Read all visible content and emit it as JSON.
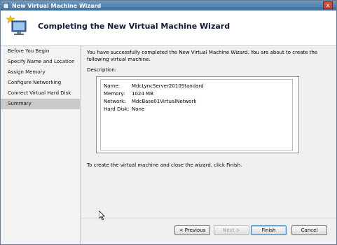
{
  "window": {
    "title": "New Virtual Machine Wizard",
    "close_glyph": "x"
  },
  "header": {
    "title": "Completing the New Virtual Machine Wizard",
    "icon": "wizard-computer-icon"
  },
  "nav": {
    "items": [
      {
        "label": "Before You Begin",
        "active": false
      },
      {
        "label": "Specify Name and Location",
        "active": false
      },
      {
        "label": "Assign Memory",
        "active": false
      },
      {
        "label": "Configure Networking",
        "active": false
      },
      {
        "label": "Connect Virtual Hard Disk",
        "active": false
      },
      {
        "label": "Summary",
        "active": true
      }
    ]
  },
  "content": {
    "intro_line1": "You have successfully completed the New Virtual Machine Wizard. You are about to create the",
    "intro_line2": "following virtual machine.",
    "description_label": "Description:",
    "description": [
      {
        "key": "Name:",
        "value": "MdcLyncServer2010Standard"
      },
      {
        "key": "Memory:",
        "value": "1024 MB"
      },
      {
        "key": "Network:",
        "value": "MdcBase01VirtualNetwork"
      },
      {
        "key": "Hard Disk:",
        "value": "None"
      }
    ],
    "footer_text": "To create the virtual machine and close the wizard, click Finish."
  },
  "buttons": {
    "previous": "< Previous",
    "next": "Next >",
    "finish": "Finish",
    "cancel": "Cancel"
  }
}
